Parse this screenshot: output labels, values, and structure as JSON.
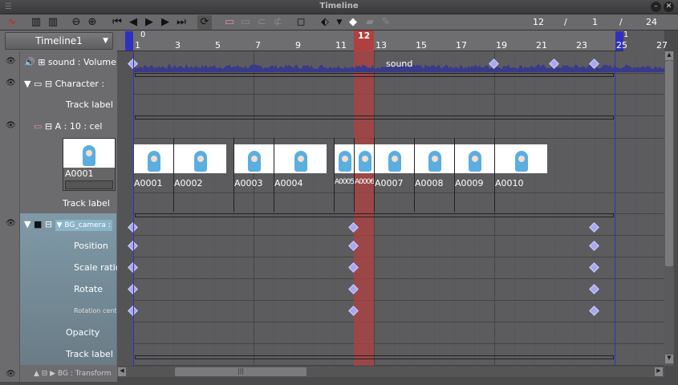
{
  "window": {
    "title": "Timeline"
  },
  "toolbar": {
    "icons": [
      "new-animation-icon",
      "frame-display-icon",
      "new-frame-display-icon",
      "zoom-out-icon",
      "zoom-in-icon",
      "first-frame-icon",
      "prev-frame-icon",
      "play-icon",
      "next-frame-icon",
      "last-frame-icon",
      "loop-icon",
      "new-cel-icon",
      "new-cel-folder-icon",
      "link-icon",
      "unlink-icon",
      "onion-skin-icon",
      "camera-keyframe-icon",
      "keyframe-icon",
      "interpolation-icon",
      "edit-icon"
    ],
    "current_frame": "12",
    "sep1": "/",
    "start_frame": "1",
    "sep2": "/",
    "end_frame": "24"
  },
  "timeline_select": {
    "value": "Timeline1"
  },
  "ruler": {
    "top_labels": {
      "start": "0",
      "end": "1"
    },
    "ticks": [
      "1",
      "3",
      "5",
      "7",
      "9",
      "11",
      "12",
      "13",
      "15",
      "17",
      "19",
      "21",
      "23",
      "25",
      "27"
    ],
    "current": 12
  },
  "tracks": {
    "sound": {
      "label": "sound : Volume",
      "wave_label": "sound",
      "keyframes": [
        0,
        19,
        22,
        24
      ]
    },
    "character": {
      "label": "Character :",
      "track_label": "Track label"
    },
    "cel": {
      "label": "A : 10 : cel",
      "preview": "A0001",
      "track_label": "Track label",
      "cels": [
        {
          "name": "A0001",
          "start": 1,
          "len": 2
        },
        {
          "name": "A0002",
          "start": 3,
          "len": 3
        },
        {
          "name": "A0003",
          "start": 6,
          "len": 2
        },
        {
          "name": "A0004",
          "start": 8,
          "len": 3
        },
        {
          "name": "A0005",
          "start": 11,
          "len": 1
        },
        {
          "name": "A0006",
          "start": 12,
          "len": 1
        },
        {
          "name": "A0007",
          "start": 13,
          "len": 2
        },
        {
          "name": "A0008",
          "start": 15,
          "len": 2
        },
        {
          "name": "A0009",
          "start": 17,
          "len": 2
        },
        {
          "name": "A0010",
          "start": 19,
          "len": 6
        }
      ]
    },
    "camera": {
      "label": "BG_camera :",
      "props": [
        "Position",
        "Scale ratio",
        "Rotate",
        "Rotation center"
      ],
      "opacity": "Opacity",
      "track_label": "Track label",
      "keyframes": [
        0,
        12,
        24
      ]
    },
    "bg": {
      "label": "BG : Transform"
    }
  },
  "colors": {
    "current_frame": "#b04040",
    "range_marker": "#3030c0",
    "keyframe": "#a8a8f0",
    "wave": "#3a3a8a"
  }
}
